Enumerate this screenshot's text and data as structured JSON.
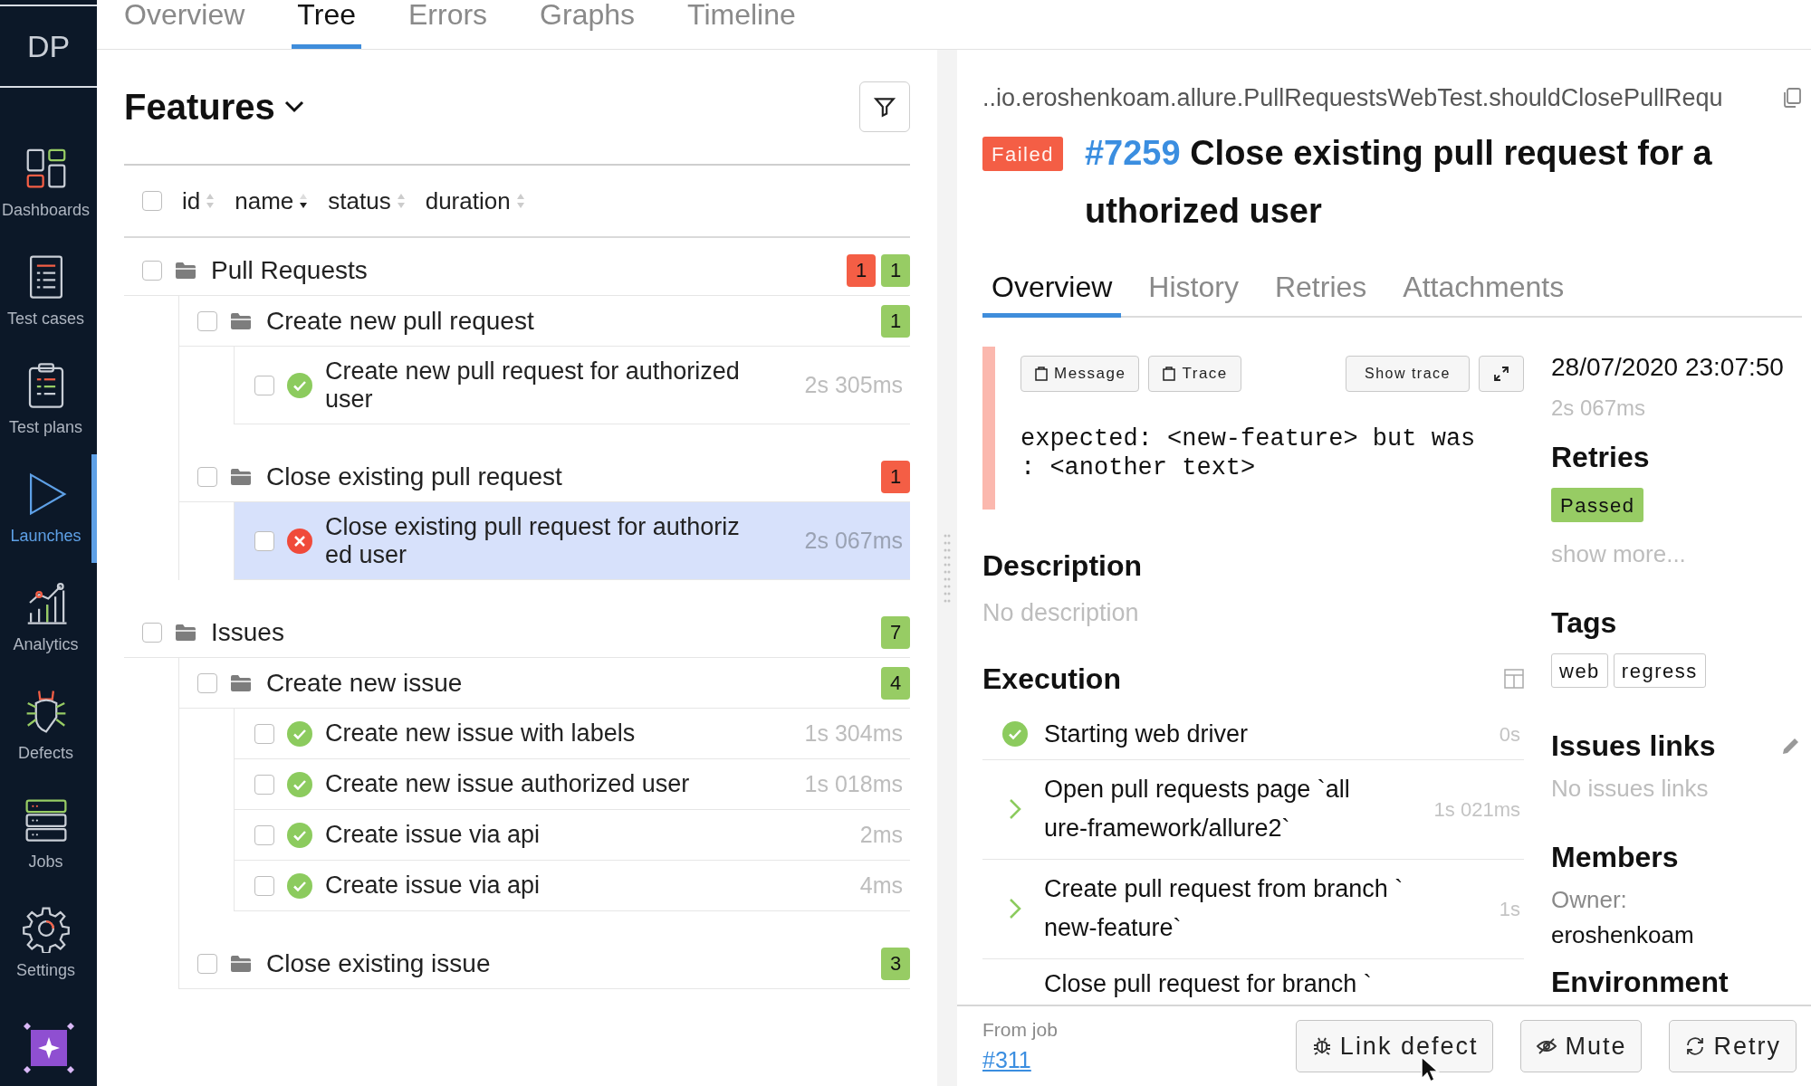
{
  "sidebar": {
    "logo": "DP",
    "items": [
      {
        "label": "Dashboards",
        "selected": false
      },
      {
        "label": "Test cases",
        "selected": false
      },
      {
        "label": "Test plans",
        "selected": false
      },
      {
        "label": "Launches",
        "selected": true
      },
      {
        "label": "Analytics",
        "selected": false
      },
      {
        "label": "Defects",
        "selected": false
      },
      {
        "label": "Jobs",
        "selected": false
      },
      {
        "label": "Settings",
        "selected": false
      }
    ]
  },
  "top_tabs": [
    {
      "label": "Overview",
      "selected": false
    },
    {
      "label": "Tree",
      "selected": true
    },
    {
      "label": "Errors",
      "selected": false
    },
    {
      "label": "Graphs",
      "selected": false
    },
    {
      "label": "Timeline",
      "selected": false
    }
  ],
  "tree": {
    "title": "Features",
    "all_checked": false,
    "columns": [
      {
        "label": "id",
        "sorted": false
      },
      {
        "label": "name",
        "sorted": true
      },
      {
        "label": "status",
        "sorted": false
      },
      {
        "label": "duration",
        "sorted": false
      }
    ],
    "items": [
      {
        "kind": "folder",
        "name": "Pull Requests",
        "checked": false,
        "counts": [
          {
            "count": "1",
            "color": "#f45e45"
          },
          {
            "count": "1",
            "color": "#97cc64"
          }
        ],
        "children": [
          {
            "kind": "folder",
            "name": "Create new pull request",
            "checked": false,
            "counts": [
              {
                "count": "1",
                "color": "#97cc64"
              }
            ],
            "children": [
              {
                "kind": "test",
                "name_lines": [
                  "Create new pull request for authorized",
                  "user"
                ],
                "failed": false,
                "duration": "2s 305ms",
                "checked": false,
                "selected": false
              }
            ]
          },
          {
            "kind": "folder",
            "name": "Close existing pull request",
            "checked": false,
            "counts": [
              {
                "count": "1",
                "color": "#f45e45"
              }
            ],
            "children": [
              {
                "kind": "test",
                "name_lines": [
                  "Close existing pull request for authoriz",
                  "ed user"
                ],
                "failed": true,
                "duration": "2s 067ms",
                "checked": false,
                "selected": true
              }
            ]
          }
        ]
      },
      {
        "kind": "folder",
        "name": "Issues",
        "checked": false,
        "counts": [
          {
            "count": "7",
            "color": "#97cc64"
          }
        ],
        "children": [
          {
            "kind": "folder",
            "name": "Create new issue",
            "checked": false,
            "counts": [
              {
                "count": "4",
                "color": "#97cc64"
              }
            ],
            "children": [
              {
                "kind": "test",
                "name_lines": [
                  "Create new issue with labels"
                ],
                "failed": false,
                "duration": "1s 304ms",
                "checked": false,
                "selected": false
              },
              {
                "kind": "test",
                "name_lines": [
                  "Create new issue authorized user"
                ],
                "failed": false,
                "duration": "1s 018ms",
                "checked": false,
                "selected": false
              },
              {
                "kind": "test",
                "name_lines": [
                  "Create issue via api"
                ],
                "failed": false,
                "duration": "2ms",
                "checked": false,
                "selected": false
              },
              {
                "kind": "test",
                "name_lines": [
                  "Create issue via api"
                ],
                "failed": false,
                "duration": "4ms",
                "checked": false,
                "selected": false
              }
            ]
          },
          {
            "kind": "folder",
            "name": "Close existing issue",
            "checked": false,
            "counts": [
              {
                "count": "3",
                "color": "#97cc64"
              }
            ]
          }
        ]
      }
    ]
  },
  "detail": {
    "path": "..io.eroshenkoam.allure.PullRequestsWebTest.shouldClosePullRequ",
    "status": {
      "label": "Failed",
      "color": "#f45e45"
    },
    "id": "#7259",
    "title_lines": [
      "Close existing pull request for a",
      "uthorized user"
    ],
    "tabs": [
      {
        "label": "Overview",
        "selected": true
      },
      {
        "label": "History",
        "selected": false
      },
      {
        "label": "Retries",
        "selected": false
      },
      {
        "label": "Attachments",
        "selected": false
      }
    ],
    "error": {
      "buttons": [
        "Message",
        "Trace"
      ],
      "show_trace": "Show trace",
      "message_lines": [
        "expected: <new-feature> but was",
        ": <another text>"
      ]
    },
    "description": {
      "heading": "Description",
      "text": "No description"
    },
    "execution": {
      "heading": "Execution",
      "steps": [
        {
          "kind": "passed",
          "lines": [
            "Starting web driver"
          ],
          "duration": "0s"
        },
        {
          "kind": "group",
          "lines": [
            "Open pull requests page `all",
            "ure-framework/allure2`"
          ],
          "duration": "1s 021ms"
        },
        {
          "kind": "group",
          "lines": [
            "Create pull request from branch `",
            "new-feature`"
          ],
          "duration": "1s"
        },
        {
          "lines": [
            "Close pull request for branch `"
          ]
        }
      ]
    },
    "side": {
      "date": "28/07/2020 23:07:50",
      "duration": "2s 067ms",
      "retries": {
        "heading": "Retries",
        "items": [
          {
            "label": "Passed",
            "color": "#97cc64"
          }
        ],
        "more": "show more..."
      },
      "tags": {
        "heading": "Tags",
        "items": [
          "web",
          "regress"
        ]
      },
      "issues": {
        "heading": "Issues links",
        "empty": "No issues links"
      },
      "members": {
        "heading": "Members",
        "owner_label": "Owner:",
        "owner": "eroshenkoam"
      },
      "environment": {
        "heading": "Environment"
      }
    }
  },
  "footer": {
    "from_job_label": "From job",
    "job_link": "#311",
    "buttons": [
      {
        "kind": "bug",
        "label": "Link defect"
      },
      {
        "kind": "mute",
        "label": "Mute"
      },
      {
        "kind": "retry",
        "label": "Retry"
      }
    ]
  }
}
